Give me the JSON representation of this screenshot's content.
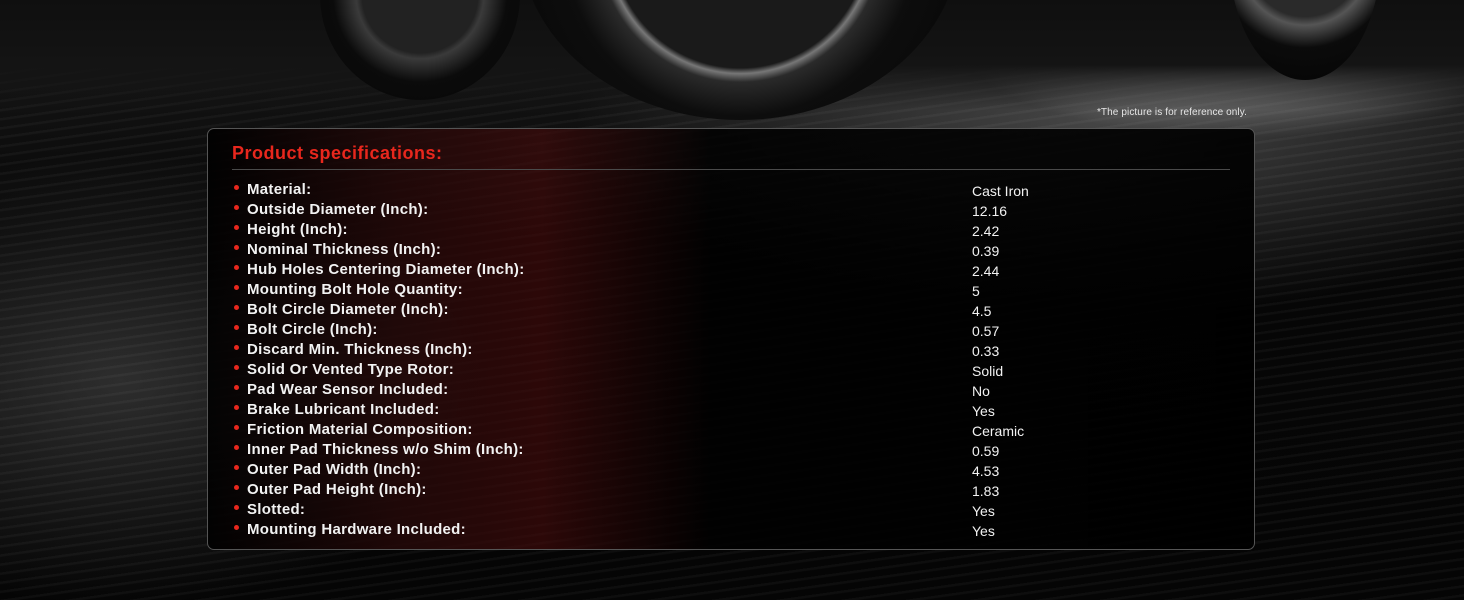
{
  "disclaimer": "*The picture is for reference only.",
  "specs": {
    "title": "Product specifications:",
    "rows": [
      {
        "label": "Material:",
        "value": "Cast Iron"
      },
      {
        "label": "Outside Diameter (Inch):",
        "value": "12.16"
      },
      {
        "label": "Height (Inch):",
        "value": "2.42"
      },
      {
        "label": "Nominal Thickness (Inch):",
        "value": "0.39"
      },
      {
        "label": "Hub Holes Centering Diameter (Inch):",
        "value": "2.44"
      },
      {
        "label": "Mounting Bolt Hole Quantity:",
        "value": "5"
      },
      {
        "label": "Bolt Circle Diameter (Inch):",
        "value": "4.5"
      },
      {
        "label": "Bolt Circle (Inch):",
        "value": "0.57"
      },
      {
        "label": "Discard Min. Thickness (Inch):",
        "value": "0.33"
      },
      {
        "label": "Solid Or Vented Type Rotor:",
        "value": "Solid"
      },
      {
        "label": "Pad Wear Sensor Included:",
        "value": "No"
      },
      {
        "label": "Brake Lubricant Included:",
        "value": "Yes"
      },
      {
        "label": "Friction Material Composition:",
        "value": "Ceramic"
      },
      {
        "label": "Inner Pad Thickness w/o Shim (Inch):",
        "value": "0.59"
      },
      {
        "label": "Outer Pad Width (Inch):",
        "value": "4.53"
      },
      {
        "label": "Outer Pad Height (Inch):",
        "value": "1.83"
      },
      {
        "label": "Slotted:",
        "value": "Yes"
      },
      {
        "label": "Mounting Hardware Included:",
        "value": "Yes"
      }
    ]
  },
  "colors": {
    "accent": "#e8271d",
    "text": "#f2f2f2",
    "border": "#555555"
  }
}
